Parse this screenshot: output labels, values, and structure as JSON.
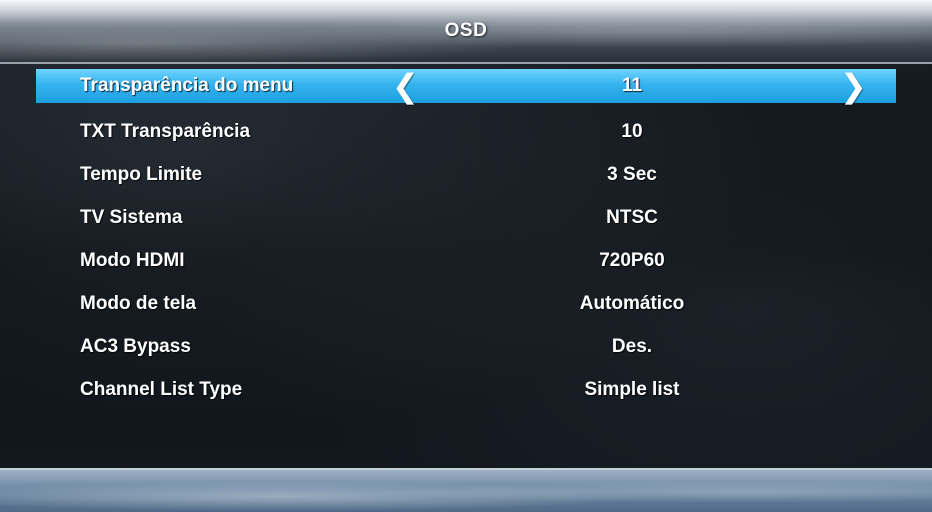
{
  "header": {
    "title": "OSD"
  },
  "menu": {
    "items": [
      {
        "label": "Transparência do menu",
        "value": "11",
        "selected": true
      },
      {
        "label": "TXT Transparência",
        "value": "10"
      },
      {
        "label": "Tempo Limite",
        "value": "3 Sec"
      },
      {
        "label": "TV Sistema",
        "value": "NTSC"
      },
      {
        "label": "Modo HDMI",
        "value": "720P60"
      },
      {
        "label": "Modo de tela",
        "value": "Automático"
      },
      {
        "label": "AC3 Bypass",
        "value": "Des."
      },
      {
        "label": "Channel List Type",
        "value": "Simple list"
      }
    ]
  },
  "icons": {
    "left_arrow": "chevron-left-icon",
    "right_arrow": "chevron-right-icon"
  },
  "colors": {
    "highlight": "#35b3ee",
    "text": "#ffffff",
    "background": "#0e1217"
  }
}
